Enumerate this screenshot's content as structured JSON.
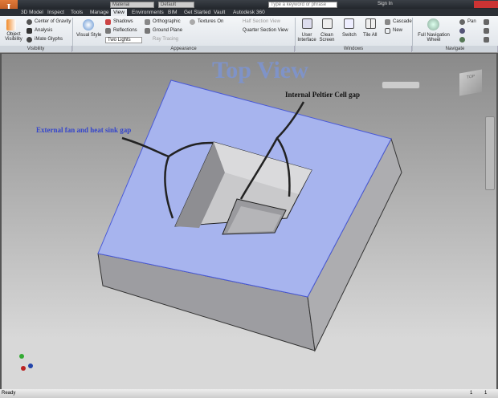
{
  "app": {
    "logo": "I",
    "qat": {
      "material": "Material",
      "appearance": "Default"
    },
    "search_placeholder": "Type a keyword or phrase",
    "sign_in": "Sign In"
  },
  "tabs": [
    "3D Model",
    "Inspect",
    "Tools",
    "Manage",
    "View",
    "Environments",
    "BIM",
    "Get Started",
    "Vault",
    "Autodesk 360"
  ],
  "active_tab": "View",
  "ribbon": {
    "visibility": {
      "object_visibility": "Object Visibility",
      "center_of_gravity": "Center of Gravity",
      "analysis": "Analysis",
      "imate_glyphs": "iMate Glyphs",
      "label": "Visibility"
    },
    "appearance": {
      "visual_style": "Visual Style",
      "shadows": "Shadows",
      "reflections": "Reflections",
      "lighting": "Two Lights",
      "orthographic": "Orthographic",
      "ground_plane": "Ground Plane",
      "ray_tracing": "Ray Tracing",
      "textures": "Textures On",
      "half_section": "Half Section View",
      "quarter_section": "Quarter Section View",
      "label": "Appearance"
    },
    "windows": {
      "user_interface": "User Interface",
      "clean_screen": "Clean Screen",
      "switch": "Switch",
      "tile_all": "Tile All",
      "cascade": "Cascade",
      "new": "New",
      "label": "Windows"
    },
    "navigate": {
      "full_nav_wheel": "Full Navigation Wheel",
      "pan": "Pan",
      "label": "Navigate"
    }
  },
  "viewport": {
    "title": "Top View",
    "label_internal": "Internal Peltier Cell gap",
    "label_external": "External fan and heat sink gap",
    "viewcube": "TOP",
    "colors": {
      "top_face": "#a7b4ee",
      "side": "#a9a9ac",
      "title": "#7f93c8",
      "external_label": "#3344cc"
    }
  },
  "status": {
    "text": "Ready",
    "n1": "1",
    "n2": "1"
  }
}
